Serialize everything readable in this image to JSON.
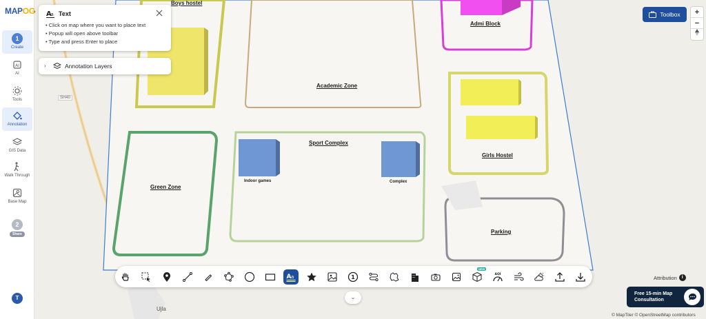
{
  "app": {
    "logo_main": "MAP",
    "logo_accent": "OG"
  },
  "sidebar": {
    "steps": {
      "create_num": "1",
      "share_num": "2"
    },
    "items": [
      {
        "label": "Create"
      },
      {
        "label": "AI"
      },
      {
        "label": "Tools"
      },
      {
        "label": "Annotation"
      },
      {
        "label": "GIS Data"
      },
      {
        "label": "Walk Through"
      },
      {
        "label": "Base Map"
      },
      {
        "label": "Share"
      }
    ],
    "avatar_initial": "T"
  },
  "text_panel": {
    "title": "Text",
    "tips": [
      "• Click on map where you want to place text",
      "• Popup will open above toolbar",
      "• Type and press Enter to place"
    ]
  },
  "layers_panel": {
    "label": "Annotation Layers"
  },
  "toolbox": {
    "label": "Toolbox"
  },
  "zoom": {
    "in": "+",
    "out": "−"
  },
  "map": {
    "labels": {
      "boys_hostel": "Boys hostel",
      "academic_zone": "Academic Zone",
      "admin_block": "Admi Block",
      "sport_complex": "Sport Complex",
      "green_zone": "Green Zone",
      "indoor_games": "Indoor games",
      "complex": "Complex",
      "girls_hostel": "Girls Hostel",
      "parking": "Parking"
    },
    "road": "SH40",
    "town": "Ujla"
  },
  "toolbar": {
    "new_badge": "NEW",
    "aqi_label": "AQI"
  },
  "attribution": {
    "label": "Attribution",
    "info": "i"
  },
  "consultation": {
    "line1": "Free 15-min Map",
    "line2": "Consultation"
  },
  "copyright": "© MapTiler © OpenStreetMap contributors",
  "colors": {
    "accent": "#1f4e9c",
    "green_zone": "#5aa36b",
    "admin_block": "#d93fd6",
    "hostel_yellow": "#efe56b",
    "building_blue": "#6f97d3"
  }
}
